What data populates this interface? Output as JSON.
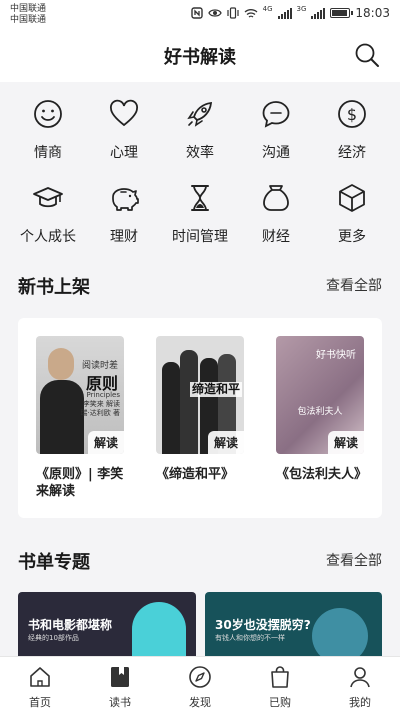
{
  "status_bar": {
    "carrier_1": "中国联通",
    "carrier_2": "中国联通",
    "network_1": "4G",
    "network_2": "3G",
    "time": "18:03",
    "battery_level": 0.8
  },
  "header": {
    "title": "好书解读",
    "search_icon": "search-icon"
  },
  "categories": [
    {
      "label": "情商",
      "icon": "smile-icon"
    },
    {
      "label": "心理",
      "icon": "heart-icon"
    },
    {
      "label": "效率",
      "icon": "rocket-icon"
    },
    {
      "label": "沟通",
      "icon": "chat-bubble-icon"
    },
    {
      "label": "经济",
      "icon": "dollar-coin-icon"
    },
    {
      "label": "个人成长",
      "icon": "graduation-cap-icon"
    },
    {
      "label": "理财",
      "icon": "piggy-bank-icon"
    },
    {
      "label": "时间管理",
      "icon": "hourglass-icon"
    },
    {
      "label": "财经",
      "icon": "money-bag-icon"
    },
    {
      "label": "更多",
      "icon": "cube-icon"
    }
  ],
  "new_books": {
    "title": "新书上架",
    "more_label": "查看全部",
    "items": [
      {
        "title": "《原则》| 李笑来解读",
        "tag": "解读",
        "cover_text": {
          "top": "阅读时差",
          "main": "原则",
          "sub": "Principles",
          "author": "李笑来 解读",
          "byline": "瑞·达利欧 著"
        }
      },
      {
        "title": "《缔造和平》",
        "tag": "解读",
        "cover_text": {
          "main": "缔造和平"
        }
      },
      {
        "title": "《包法利夫人》",
        "tag": "解读",
        "cover_text": {
          "main": "包法利夫人",
          "corner": "好书快听"
        }
      }
    ]
  },
  "book_lists": {
    "title": "书单专题",
    "more_label": "查看全部",
    "banners": [
      {
        "title": "书和电影都堪称",
        "subtitle": "经典的10部作品"
      },
      {
        "title": "30岁也没摆脱穷?",
        "subtitle": "有钱人和你想的不一样"
      }
    ]
  },
  "tab_bar": [
    {
      "label": "首页",
      "icon": "home-icon"
    },
    {
      "label": "读书",
      "icon": "book-icon"
    },
    {
      "label": "发现",
      "icon": "compass-icon"
    },
    {
      "label": "已购",
      "icon": "shopping-bag-icon"
    },
    {
      "label": "我的",
      "icon": "user-icon"
    }
  ],
  "colors": {
    "background": "#f4f4f6",
    "card": "#ffffff",
    "text": "#222222"
  }
}
